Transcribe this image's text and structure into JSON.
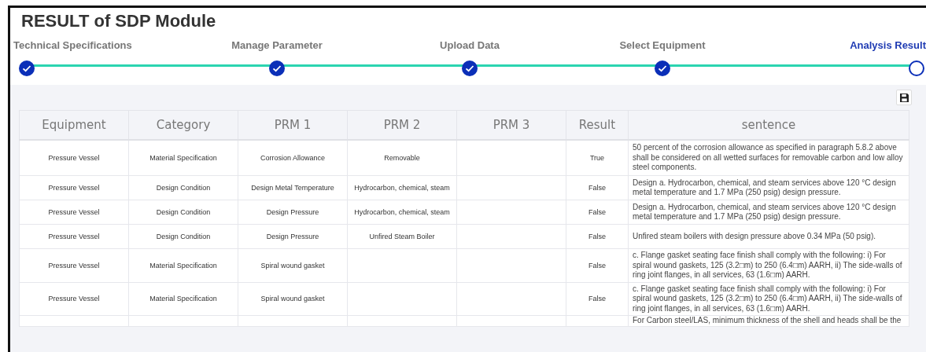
{
  "title": "RESULT of SDP Module",
  "steps": [
    {
      "label": "Technical Specifications",
      "completed": true,
      "selected": false
    },
    {
      "label": "Manage Parameter",
      "completed": true,
      "selected": false
    },
    {
      "label": "Upload Data",
      "completed": true,
      "selected": false
    },
    {
      "label": "Select Equipment",
      "completed": true,
      "selected": false
    },
    {
      "label": "Analysis Result",
      "completed": false,
      "selected": true
    }
  ],
  "table": {
    "columns": [
      "Equipment",
      "Category",
      "PRM 1",
      "PRM 2",
      "PRM 3",
      "Result",
      "sentence"
    ],
    "rows": [
      [
        "Pressure Vessel",
        "Material Specification",
        "Corrosion Allowance",
        "Removable",
        "",
        "True",
        "50 percent of the corrosion allowance as specified in paragraph 5.8.2 above shall be considered on all wetted surfaces for removable carbon and low alloy steel components."
      ],
      [
        "Pressure Vessel",
        "Design Condition",
        "Design Metal Temperature",
        "Hydrocarbon, chemical, steam",
        "",
        "False",
        "Design a. Hydrocarbon, chemical, and steam services above 120 °C design metal temperature and 1.7 MPa (250 psig) design pressure."
      ],
      [
        "Pressure Vessel",
        "Design Condition",
        "Design Pressure",
        "Hydrocarbon, chemical, steam",
        "",
        "False",
        "Design a. Hydrocarbon, chemical, and steam services above 120 °C design metal temperature and 1.7 MPa (250 psig) design pressure."
      ],
      [
        "Pressure Vessel",
        "Design Condition",
        "Design Pressure",
        "Unfired Steam Boiler",
        "",
        "False",
        "Unfired steam boilers with design pressure above 0.34 MPa (50 psig)."
      ],
      [
        "Pressure Vessel",
        "Material Specification",
        "Spiral wound gasket",
        "",
        "",
        "False",
        "c. Flange gasket seating face finish shall comply with the following: i) For spiral wound gaskets, 125 (3.2□m) to 250 (6.4□m) AARH, ii) The side-walls of ring joint flanges, in all services, 63 (1.6□m) AARH."
      ],
      [
        "Pressure Vessel",
        "Material Specification",
        "Spiral wound gasket",
        "",
        "",
        "False",
        "c. Flange gasket seating face finish shall comply with the following: i) For spiral wound gaskets, 125 (3.2□m) to 250 (6.4□m) AARH, ii) The side-walls of ring joint flanges, in all services, 63 (1.6□m) AARH."
      ],
      [
        "",
        "",
        "",
        "",
        "",
        "",
        "For Carbon steel/LAS, minimum thickness of the shell and heads shall be the"
      ]
    ]
  }
}
